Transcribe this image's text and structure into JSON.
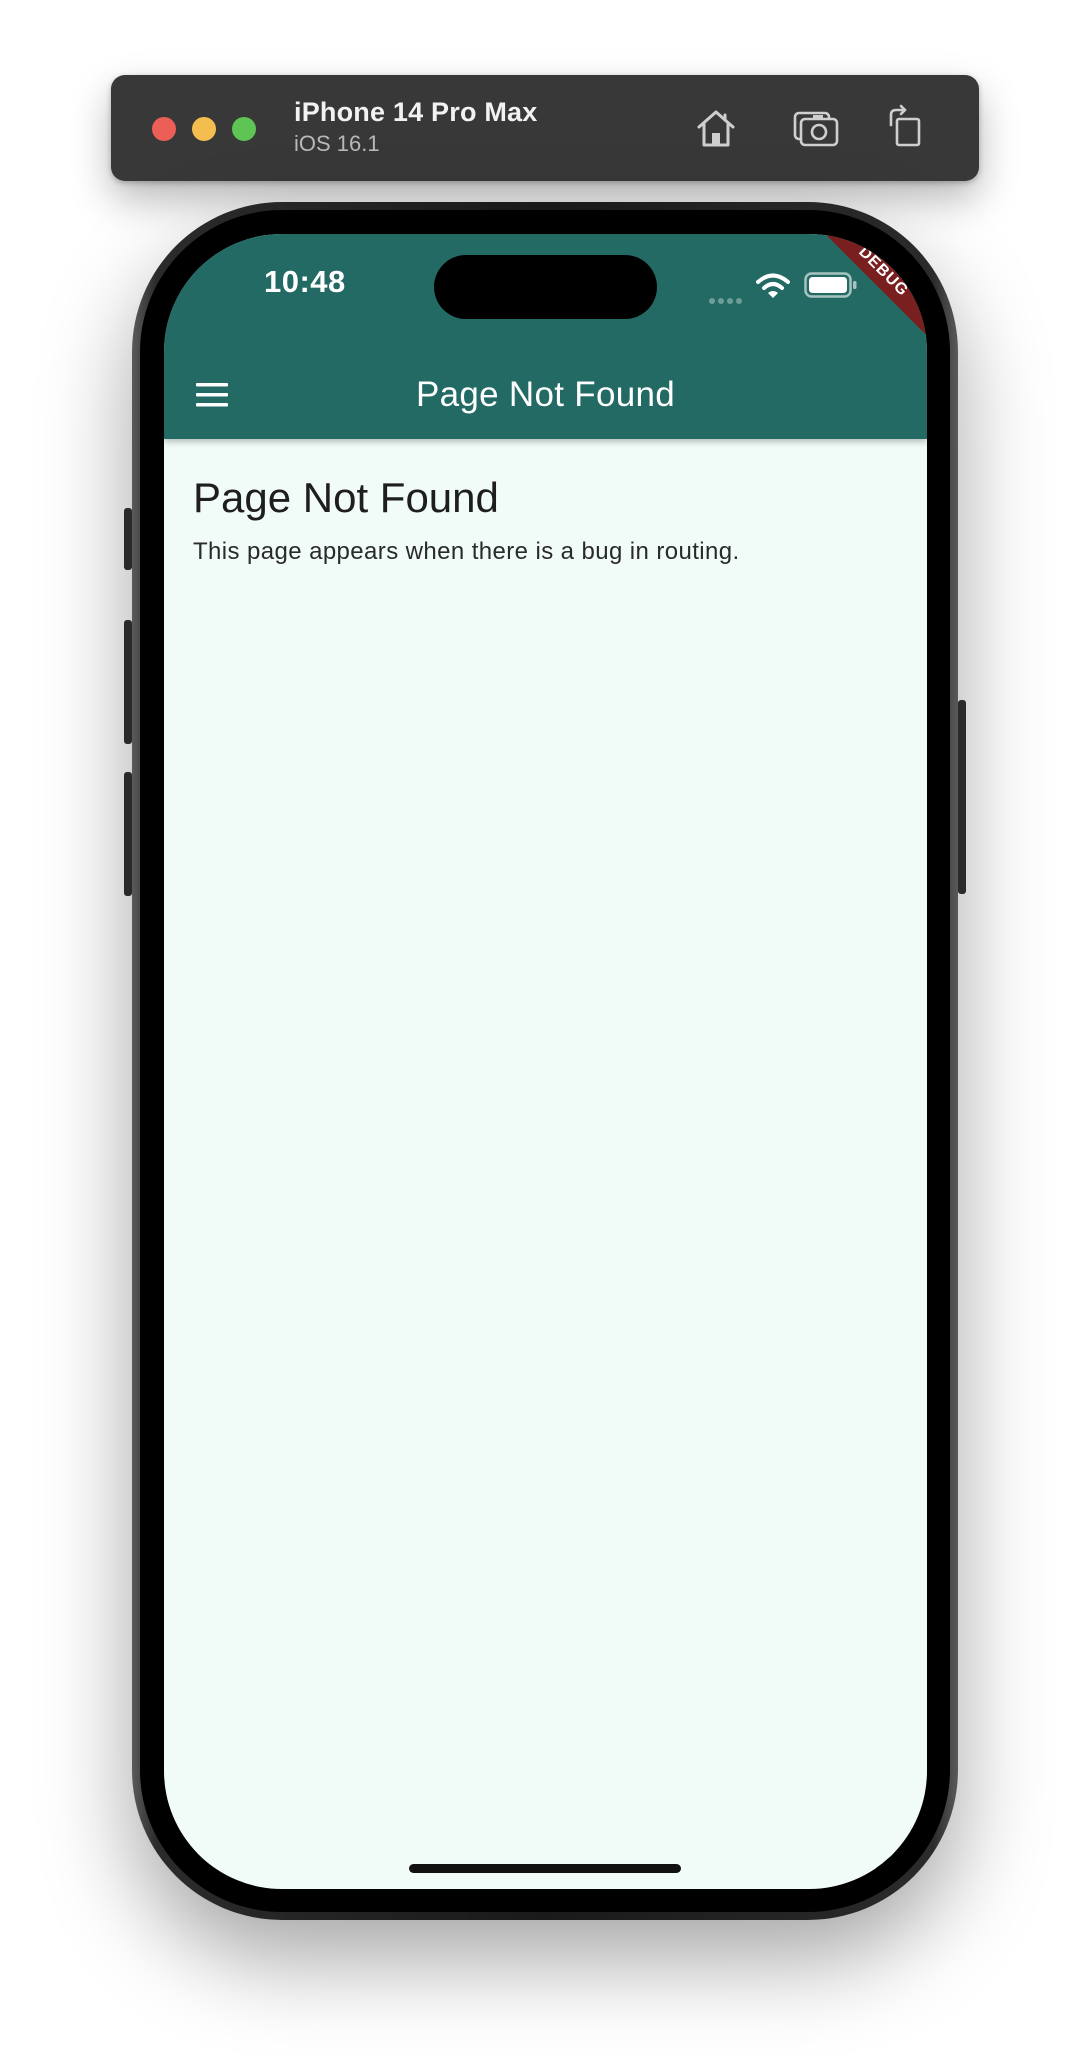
{
  "simulator": {
    "device_name": "iPhone 14 Pro Max",
    "os_version": "iOS 16.1",
    "buttons": {
      "home": "home-icon",
      "screenshot": "camera-icon",
      "rotate": "rotate-icon"
    }
  },
  "status_bar": {
    "time": "10:48"
  },
  "app_bar": {
    "title": "Page Not Found",
    "menu_icon": "hamburger-menu-icon",
    "color": "#226a63"
  },
  "debug_banner": {
    "label": "DEBUG",
    "color": "#7a1f1f"
  },
  "content": {
    "heading": "Page Not Found",
    "body": "This page appears when there is a bug in routing."
  },
  "colors": {
    "screen_background": "#f1fcf9",
    "close": "#ec5f57",
    "minimize": "#f4bd4f",
    "maximize": "#5ec454"
  }
}
